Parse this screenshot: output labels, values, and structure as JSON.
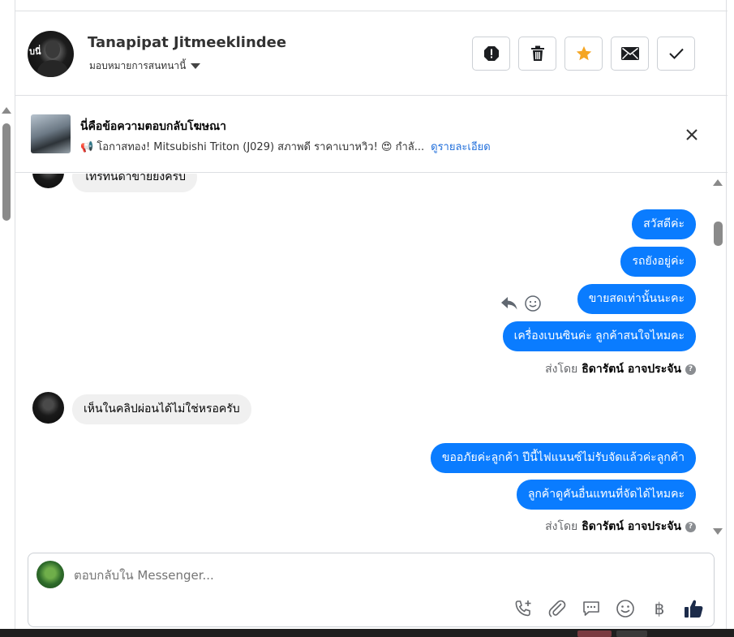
{
  "header": {
    "contact_name": "Tanapipat Jitmeeklindee",
    "assign_label": "มอบหมายการสนทนานี้",
    "avatar_tag": "บนี่"
  },
  "actions": [
    {
      "icon": "alert-icon"
    },
    {
      "icon": "trash-icon"
    },
    {
      "icon": "star-icon",
      "color": "#f5a623"
    },
    {
      "icon": "mail-icon"
    },
    {
      "icon": "check-icon"
    }
  ],
  "ad": {
    "title": "นี่คือข้อความตอบกลับโฆษณา",
    "description": "📢 โอกาสทอง! Mitsubishi Triton (J029) สภาพดี ราคาเบาหวิว! 😍 กำลั...",
    "details_link": "ดูรายละเอียด"
  },
  "messages": {
    "top_partial": "ไทรทันดาขายยังครับ",
    "outgoing_group1": [
      "สวัสดีค่ะ",
      "รถยังอยู่ค่ะ",
      "ขายสดเท่านั้นนะคะ",
      "เครื่องเบนซินค่ะ ลูกค้าสนใจไหมคะ"
    ],
    "sent_by_prefix": "ส่งโดย",
    "sent_by_name": "ธิดารัตน์ อาจประจัน",
    "incoming_2": "เห็นในคลิปผ่อนได้ไม่ใช่หรอครับ",
    "outgoing_group2": [
      "ขออภัยค่ะลูกค้า ปีนี้ไฟแนนซ์ไม่รับจัดแล้วค่ะลูกค้า",
      "ลูกค้าดูคันอื่นแทนที่จัดได้ไหมคะ"
    ],
    "qmark": "?"
  },
  "composer": {
    "placeholder": "ตอบกลับใน Messenger...",
    "baht_symbol": "฿"
  },
  "colors": {
    "accent": "#0a7cff",
    "incoming_bubble": "#f0f0f0",
    "link": "#216fdb"
  }
}
